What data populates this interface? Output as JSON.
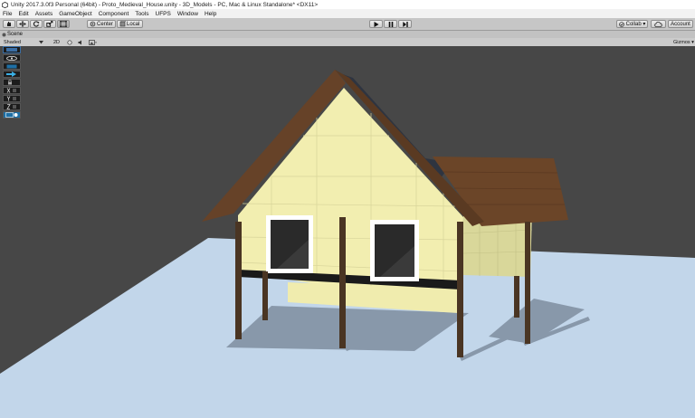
{
  "window": {
    "title": "Unity 2017.3.0f3 Personal (64bit) - Proto_Medieval_House.unity - 3D_Models - PC, Mac & Linux Standalone* <DX11>"
  },
  "menu": [
    "File",
    "Edit",
    "Assets",
    "GameObject",
    "Component",
    "Tools",
    "UFPS",
    "Window",
    "Help"
  ],
  "toolbar": {
    "tools": [
      "hand-tool",
      "move-tool",
      "rotate-tool",
      "scale-tool",
      "rect-tool"
    ],
    "pivot_label": "Center",
    "space_label": "Local",
    "collab_label": "Collab ▾",
    "account_label": "Account"
  },
  "scene_tab": {
    "label": "Scene"
  },
  "scene_bar": {
    "shading_mode": "Shaded",
    "toggle_2d": "2D",
    "gizmos_label": "Gizmos ▾"
  },
  "palette_buttons": [
    "layer",
    "visibility",
    "on",
    "arrow",
    "lock",
    "x",
    "y",
    "z",
    "scene"
  ],
  "colors": {
    "scene_background": "#474747",
    "ground_plane": "#c2d6ea",
    "wall": "#f2eeb0",
    "roof": "#5e3a22",
    "post": "#4a3523"
  }
}
